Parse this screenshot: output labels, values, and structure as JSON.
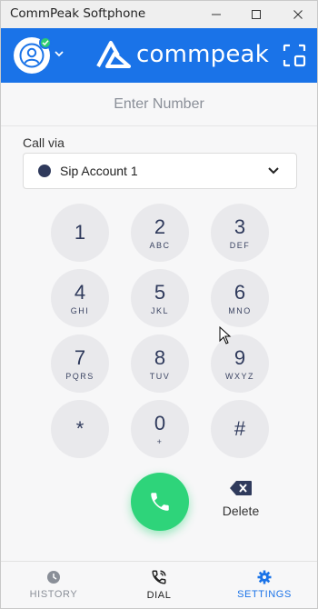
{
  "window": {
    "title": "CommPeak Softphone"
  },
  "header": {
    "brand": "commpeak",
    "status": "online",
    "accent": "#1a73e8"
  },
  "dialer": {
    "number_placeholder": "Enter Number",
    "number_value": "",
    "call_via_label": "Call via",
    "call_via_selected": "Sip Account 1"
  },
  "keypad": [
    {
      "digit": "1",
      "letters": ""
    },
    {
      "digit": "2",
      "letters": "ABC"
    },
    {
      "digit": "3",
      "letters": "DEF"
    },
    {
      "digit": "4",
      "letters": "GHI"
    },
    {
      "digit": "5",
      "letters": "JKL"
    },
    {
      "digit": "6",
      "letters": "MNO"
    },
    {
      "digit": "7",
      "letters": "PQRS"
    },
    {
      "digit": "8",
      "letters": "TUV"
    },
    {
      "digit": "9",
      "letters": "WXYZ"
    },
    {
      "digit": "*",
      "letters": ""
    },
    {
      "digit": "0",
      "letters": "+"
    },
    {
      "digit": "#",
      "letters": ""
    }
  ],
  "actions": {
    "delete_label": "Delete",
    "call_color": "#2ed47a"
  },
  "nav": {
    "history": "HISTORY",
    "dial": "DIAL",
    "settings": "SETTINGS"
  }
}
